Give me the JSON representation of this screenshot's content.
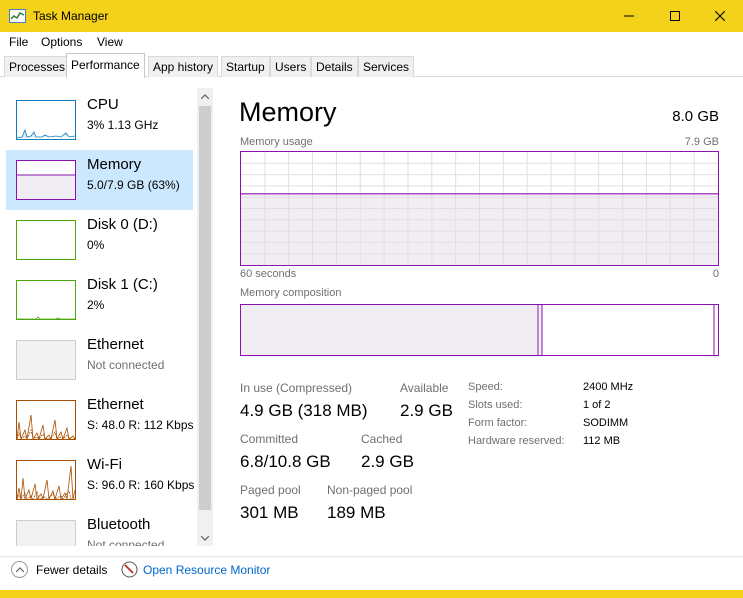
{
  "window": {
    "title": "Task Manager",
    "accent_color": "#f4d11b"
  },
  "menu": [
    "File",
    "Options",
    "View"
  ],
  "tabs": [
    "Processes",
    "Performance",
    "App history",
    "Startup",
    "Users",
    "Details",
    "Services"
  ],
  "sidebar": {
    "items": [
      {
        "name": "CPU",
        "sub": "3%  1.13 GHz",
        "color": "#117dbb"
      },
      {
        "name": "Memory",
        "sub": "5.0/7.9 GB (63%)",
        "color": "#8b12ae"
      },
      {
        "name": "Disk 0 (D:)",
        "sub": "0%",
        "color": "#4da60c"
      },
      {
        "name": "Disk 1 (C:)",
        "sub": "2%",
        "color": "#4da60c"
      },
      {
        "name": "Ethernet",
        "sub": "Not connected",
        "color": "#a74f01"
      },
      {
        "name": "Ethernet",
        "sub": "S: 48.0  R: 112 Kbps",
        "color": "#a74f01"
      },
      {
        "name": "Wi-Fi",
        "sub": "S: 96.0  R: 160 Kbps",
        "color": "#a74f01"
      },
      {
        "name": "Bluetooth",
        "sub": "Not connected",
        "color": "#a74f01"
      }
    ]
  },
  "main": {
    "title": "Memory",
    "total": "8.0 GB",
    "usage_label": "Memory usage",
    "usage_max": "7.9 GB",
    "time_left": "60 seconds",
    "time_right": "0",
    "composition_label": "Memory composition",
    "accent": "#8b12ae",
    "usage_fraction": 0.63
  },
  "stats": {
    "in_use_label": "In use (Compressed)",
    "in_use_value": "4.9 GB (318 MB)",
    "available_label": "Available",
    "available_value": "2.9 GB",
    "committed_label": "Committed",
    "committed_value": "6.8/10.8 GB",
    "cached_label": "Cached",
    "cached_value": "2.9 GB",
    "paged_label": "Paged pool",
    "paged_value": "301 MB",
    "nonpaged_label": "Non-paged pool",
    "nonpaged_value": "189 MB"
  },
  "specs": [
    {
      "label": "Speed:",
      "value": "2400 MHz"
    },
    {
      "label": "Slots used:",
      "value": "1 of 2"
    },
    {
      "label": "Form factor:",
      "value": "SODIMM"
    },
    {
      "label": "Hardware reserved:",
      "value": "112 MB"
    }
  ],
  "footer": {
    "fewer_details": "Fewer details",
    "open_monitor": "Open Resource Monitor"
  }
}
